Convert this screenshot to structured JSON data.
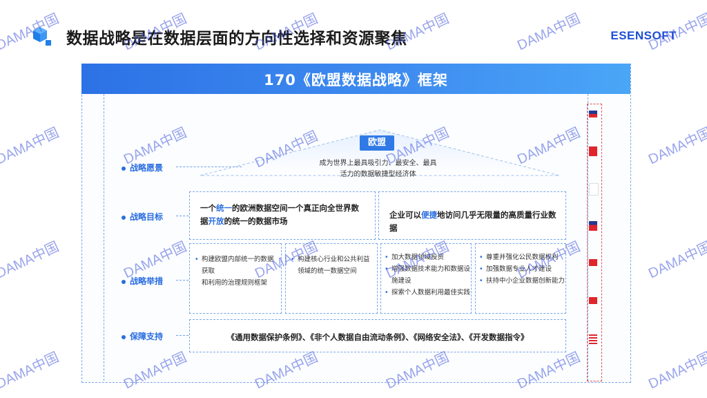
{
  "slide": {
    "title": "数据战略是在数据层面的方向性选择和资源聚焦",
    "brand": "ESENSOFT"
  },
  "panel": {
    "title": "170《欧盟数据战略》框架"
  },
  "vision": {
    "badge": "欧盟",
    "line1": "成为世界上最具吸引力、最安全、最具",
    "line2": "活力的数据敏捷型经济体"
  },
  "rows": {
    "vision_label": "战略愿景",
    "goals_label": "战略目标",
    "actions_label": "战略举措",
    "support_label": "保障支持"
  },
  "goals": {
    "left_a": "一个",
    "left_hl1": "统一",
    "left_b": "的欧洲数据空间一个真正向全世界数据",
    "left_hl2": "开放",
    "left_c": "的统一的数据市场",
    "right_a": "企业可以",
    "right_hl": "便捷",
    "right_b": "地访问几乎无限量的高质量行业数据"
  },
  "actions": {
    "box1": [
      "构建欧盟内部统一的数据获取",
      "和利用的治理规则框架"
    ],
    "box2": [
      "构建核心行业和公共利益",
      "领域的统一数据空间"
    ],
    "box3": [
      "加大数据领域投资",
      "增强数据技术能力和数据设",
      "施建设",
      "探索个人数据利用最佳实践"
    ],
    "box4": [
      "尊重并强化公民数据权利",
      "加强数据专业人才建设",
      "扶持中小企业数据创新能力"
    ]
  },
  "support": {
    "text": "《通用数据保护条例》、《非个人数据自由流动条例》、《网络安全法》、《开发数据指令》"
  },
  "watermark": "DAMA中国",
  "colors": {
    "accent": "#2a6de0",
    "header": "#2c72e6",
    "flag_red": "#e0252b",
    "flag_blue": "#253a8f"
  }
}
